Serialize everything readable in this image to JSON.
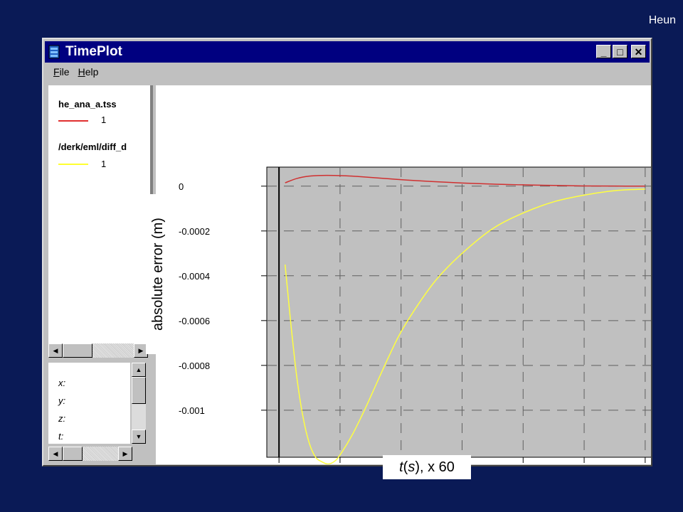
{
  "corner_label": "Heun",
  "window": {
    "title": "TimePlot",
    "menu": [
      {
        "label": "File",
        "accel": "F",
        "rest": "ile"
      },
      {
        "label": "Help",
        "accel": "H",
        "rest": "elp"
      }
    ],
    "controls": {
      "minimize": "_",
      "maximize": "□",
      "close": "✕"
    }
  },
  "legend": [
    {
      "file": "he_ana_a.tss",
      "value": "1",
      "color": "#e03030"
    },
    {
      "file": "/derk/eml/diff_d",
      "value": "1",
      "color": "#ffff30"
    }
  ],
  "coords": [
    "x:",
    "y:",
    "z:",
    "t:"
  ],
  "chart_data": {
    "type": "line",
    "xlabel_italic": "t",
    "xlabel_var": "s",
    "xlabel_suffix": ", x 60",
    "ylabel": "absolute error (m)",
    "xlim": [
      -2,
      62
    ],
    "ylim": [
      -0.00121,
      8.5e-05
    ],
    "x_ticks": [
      0,
      10,
      20,
      30,
      40,
      50,
      60
    ],
    "y_ticks": [
      0,
      -0.0002,
      -0.0004,
      -0.0006,
      -0.0008,
      -0.001
    ],
    "y_tick_labels": [
      "0",
      "-0.0002",
      "-0.0004",
      "-0.0006",
      "-0.0008",
      "-0.001"
    ],
    "grid": true,
    "colors": {
      "background": "#c0c0c0",
      "grid": "#606060"
    },
    "series": [
      {
        "color": "#d03030",
        "x": [
          1,
          3,
          5,
          7,
          9,
          11,
          13,
          15,
          18,
          21,
          25,
          30,
          35,
          40,
          45,
          50,
          55,
          60
        ],
        "y": [
          1.5e-05,
          3.5e-05,
          4.5e-05,
          4.8e-05,
          4.8e-05,
          4.6e-05,
          4.3e-05,
          3.9e-05,
          3.3e-05,
          2.7e-05,
          2.1e-05,
          1.4e-05,
          9e-06,
          6e-06,
          3e-06,
          1e-06,
          5e-07,
          0.0
        ]
      },
      {
        "color": "#ffff40",
        "x": [
          1,
          2,
          3,
          4,
          5,
          6,
          7,
          8,
          9,
          10,
          12,
          14,
          16,
          18,
          20,
          23,
          26,
          30,
          35,
          40,
          45,
          50,
          55,
          60
        ],
        "y": [
          -0.00035,
          -0.00063,
          -0.00087,
          -0.00104,
          -0.00115,
          -0.00121,
          -0.00123,
          -0.00124,
          -0.00123,
          -0.0012,
          -0.00111,
          -0.001,
          -0.00088,
          -0.00076,
          -0.00065,
          -0.00052,
          -0.00041,
          -0.0003,
          -0.00019,
          -0.00012,
          -7e-05,
          -4e-05,
          -2e-05,
          -1.3e-05
        ]
      }
    ]
  }
}
